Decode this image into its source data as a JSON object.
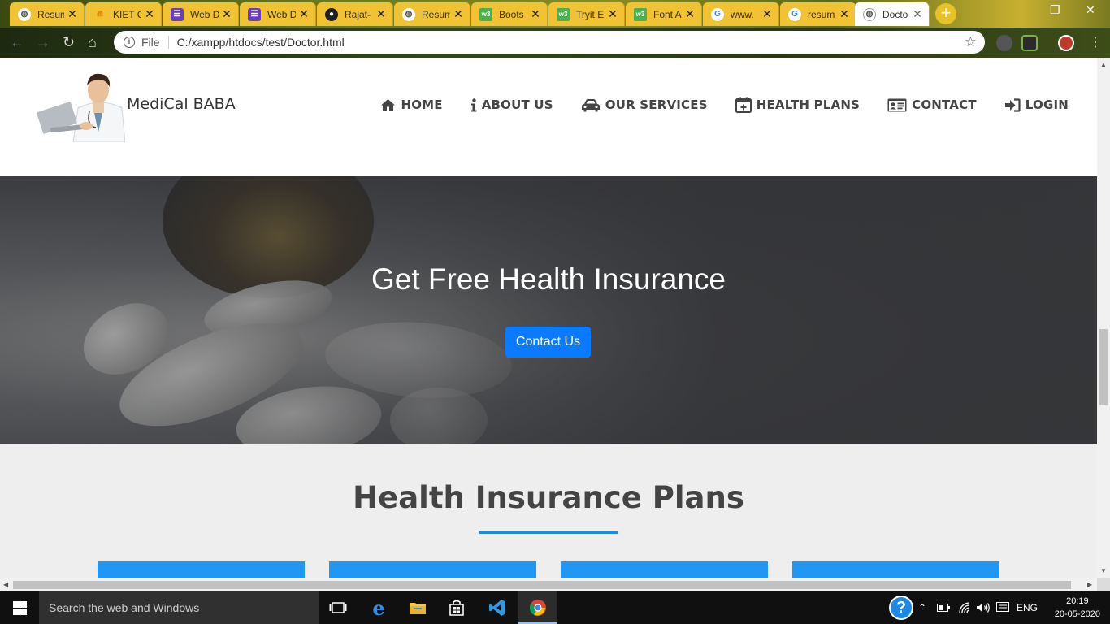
{
  "browser": {
    "tabs": [
      {
        "title": "Resum",
        "icon": "globe-icon",
        "color": "#ffffff"
      },
      {
        "title": "KIET C",
        "icon": "kiet-logo-icon",
        "color": "#e07b00"
      },
      {
        "title": "Web D",
        "icon": "list-app-icon",
        "color": "#6a3fb5"
      },
      {
        "title": "Web D",
        "icon": "list-app-icon",
        "color": "#6a3fb5"
      },
      {
        "title": "Rajat-",
        "icon": "github-icon",
        "color": "#222222"
      },
      {
        "title": "Resum",
        "icon": "globe-icon",
        "color": "#ffffff"
      },
      {
        "title": "Boots",
        "icon": "w3schools-icon",
        "color": "#4caf50"
      },
      {
        "title": "Tryit E",
        "icon": "w3schools-icon",
        "color": "#4caf50"
      },
      {
        "title": "Font A",
        "icon": "w3schools-icon",
        "color": "#4caf50"
      },
      {
        "title": "www.",
        "icon": "google-icon",
        "color": "#ffffff"
      },
      {
        "title": "resum",
        "icon": "google-icon",
        "color": "#ffffff"
      },
      {
        "title": "Docto",
        "icon": "globe-icon",
        "color": "#ffffff"
      }
    ],
    "address": {
      "scheme": "File",
      "url": "C:/xampp/htdocs/test/Doctor.html"
    }
  },
  "site": {
    "brand": "MediCal BABA",
    "nav": [
      {
        "label": "HOME",
        "icon": "home-icon"
      },
      {
        "label": "ABOUT US",
        "icon": "info-icon"
      },
      {
        "label": "OUR SERVICES",
        "icon": "car-icon"
      },
      {
        "label": "HEALTH PLANS",
        "icon": "calendar-plus-icon"
      },
      {
        "label": "CONTACT",
        "icon": "id-card-icon"
      },
      {
        "label": "LOGIN",
        "icon": "sign-in-icon"
      }
    ],
    "hero": {
      "title": "Get Free Health Insurance",
      "button": "Contact Us"
    },
    "plans": {
      "title": "Health Insurance Plans"
    }
  },
  "taskbar": {
    "search_placeholder": "Search the web and Windows",
    "language": "ENG",
    "time": "20:19",
    "date": "20-05-2020"
  },
  "colors": {
    "accent_blue": "#0a7bff",
    "plan_blue": "#2196f3",
    "tab_yellow": "#f1c232"
  }
}
